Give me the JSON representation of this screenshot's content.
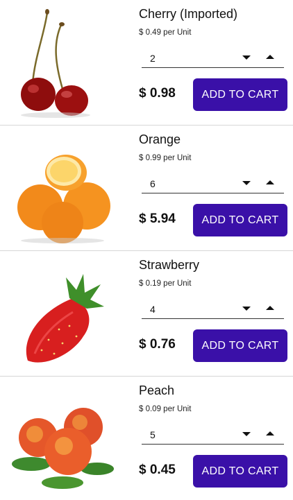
{
  "products": [
    {
      "name": "Cherry (Imported)",
      "unit_price": "$ 0.49 per Unit",
      "quantity": "2",
      "total": "$ 0.98",
      "button": "ADD TO CART",
      "image_icon": "cherry-image"
    },
    {
      "name": "Orange",
      "unit_price": "$ 0.99 per Unit",
      "quantity": "6",
      "total": "$ 5.94",
      "button": "ADD TO CART",
      "image_icon": "orange-image"
    },
    {
      "name": "Strawberry",
      "unit_price": "$ 0.19 per Unit",
      "quantity": "4",
      "total": "$ 0.76",
      "button": "ADD TO CART",
      "image_icon": "strawberry-image"
    },
    {
      "name": "Peach",
      "unit_price": "$ 0.09 per Unit",
      "quantity": "5",
      "total": "$ 0.45",
      "button": "ADD TO CART",
      "image_icon": "peach-image"
    }
  ],
  "colors": {
    "button_bg": "#3a10a8",
    "button_text": "#ffffff",
    "divider": "#d6d6d6"
  }
}
